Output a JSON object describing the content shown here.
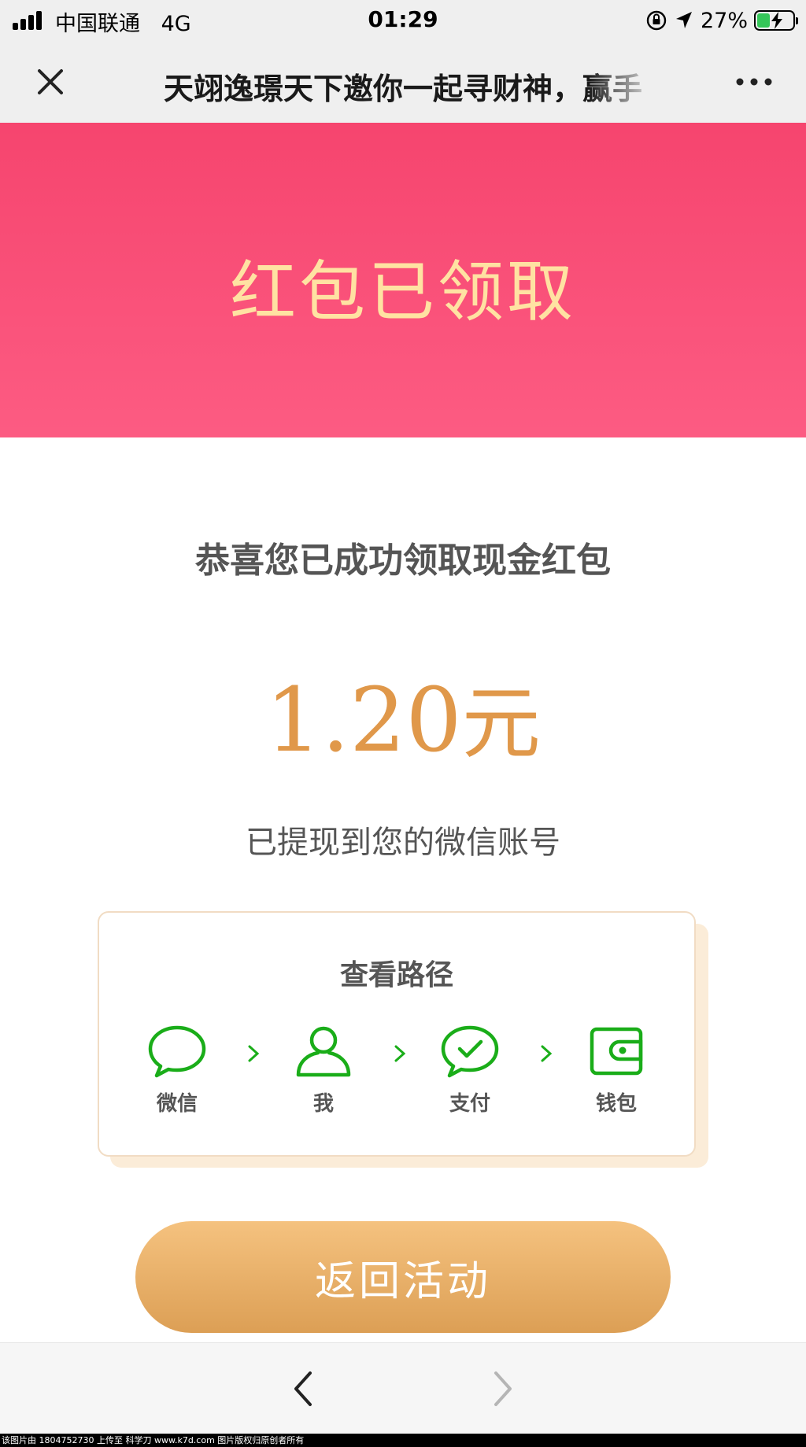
{
  "status_bar": {
    "carrier": "中国联通",
    "network": "4G",
    "time": "01:29",
    "battery_percent": "27%",
    "battery_level": 0.27,
    "signal_bars": 4
  },
  "nav": {
    "title": "天翊逸璟天下邀你一起寻财神，赢手",
    "close_icon": "close-icon",
    "more_icon": "more-icon"
  },
  "hero": {
    "title": "红包已领取"
  },
  "result": {
    "congrats": "恭喜您已成功领取现金红包",
    "amount_value": "1.20",
    "amount_unit": "元",
    "withdrawn_text": "已提现到您的微信账号"
  },
  "path_card": {
    "title": "查看路径",
    "steps": [
      {
        "label": "微信",
        "icon": "chat-bubble-icon"
      },
      {
        "label": "我",
        "icon": "person-icon"
      },
      {
        "label": "支付",
        "icon": "pay-check-icon"
      },
      {
        "label": "钱包",
        "icon": "wallet-icon"
      }
    ]
  },
  "actions": {
    "return_label": "返回活动"
  },
  "toolbar": {
    "back_icon": "chevron-left-icon",
    "forward_icon": "chevron-right-icon"
  },
  "watermark": "该图片由 1804752730 上传至 科学刀 www.k7d.com 图片版权归原创者所有",
  "colors": {
    "header_red": "#f5426c",
    "hero_text": "#ffe2a2",
    "amount": "#e0984a",
    "wechat_green": "#1aad19",
    "button_gold": "#dc9f55"
  }
}
